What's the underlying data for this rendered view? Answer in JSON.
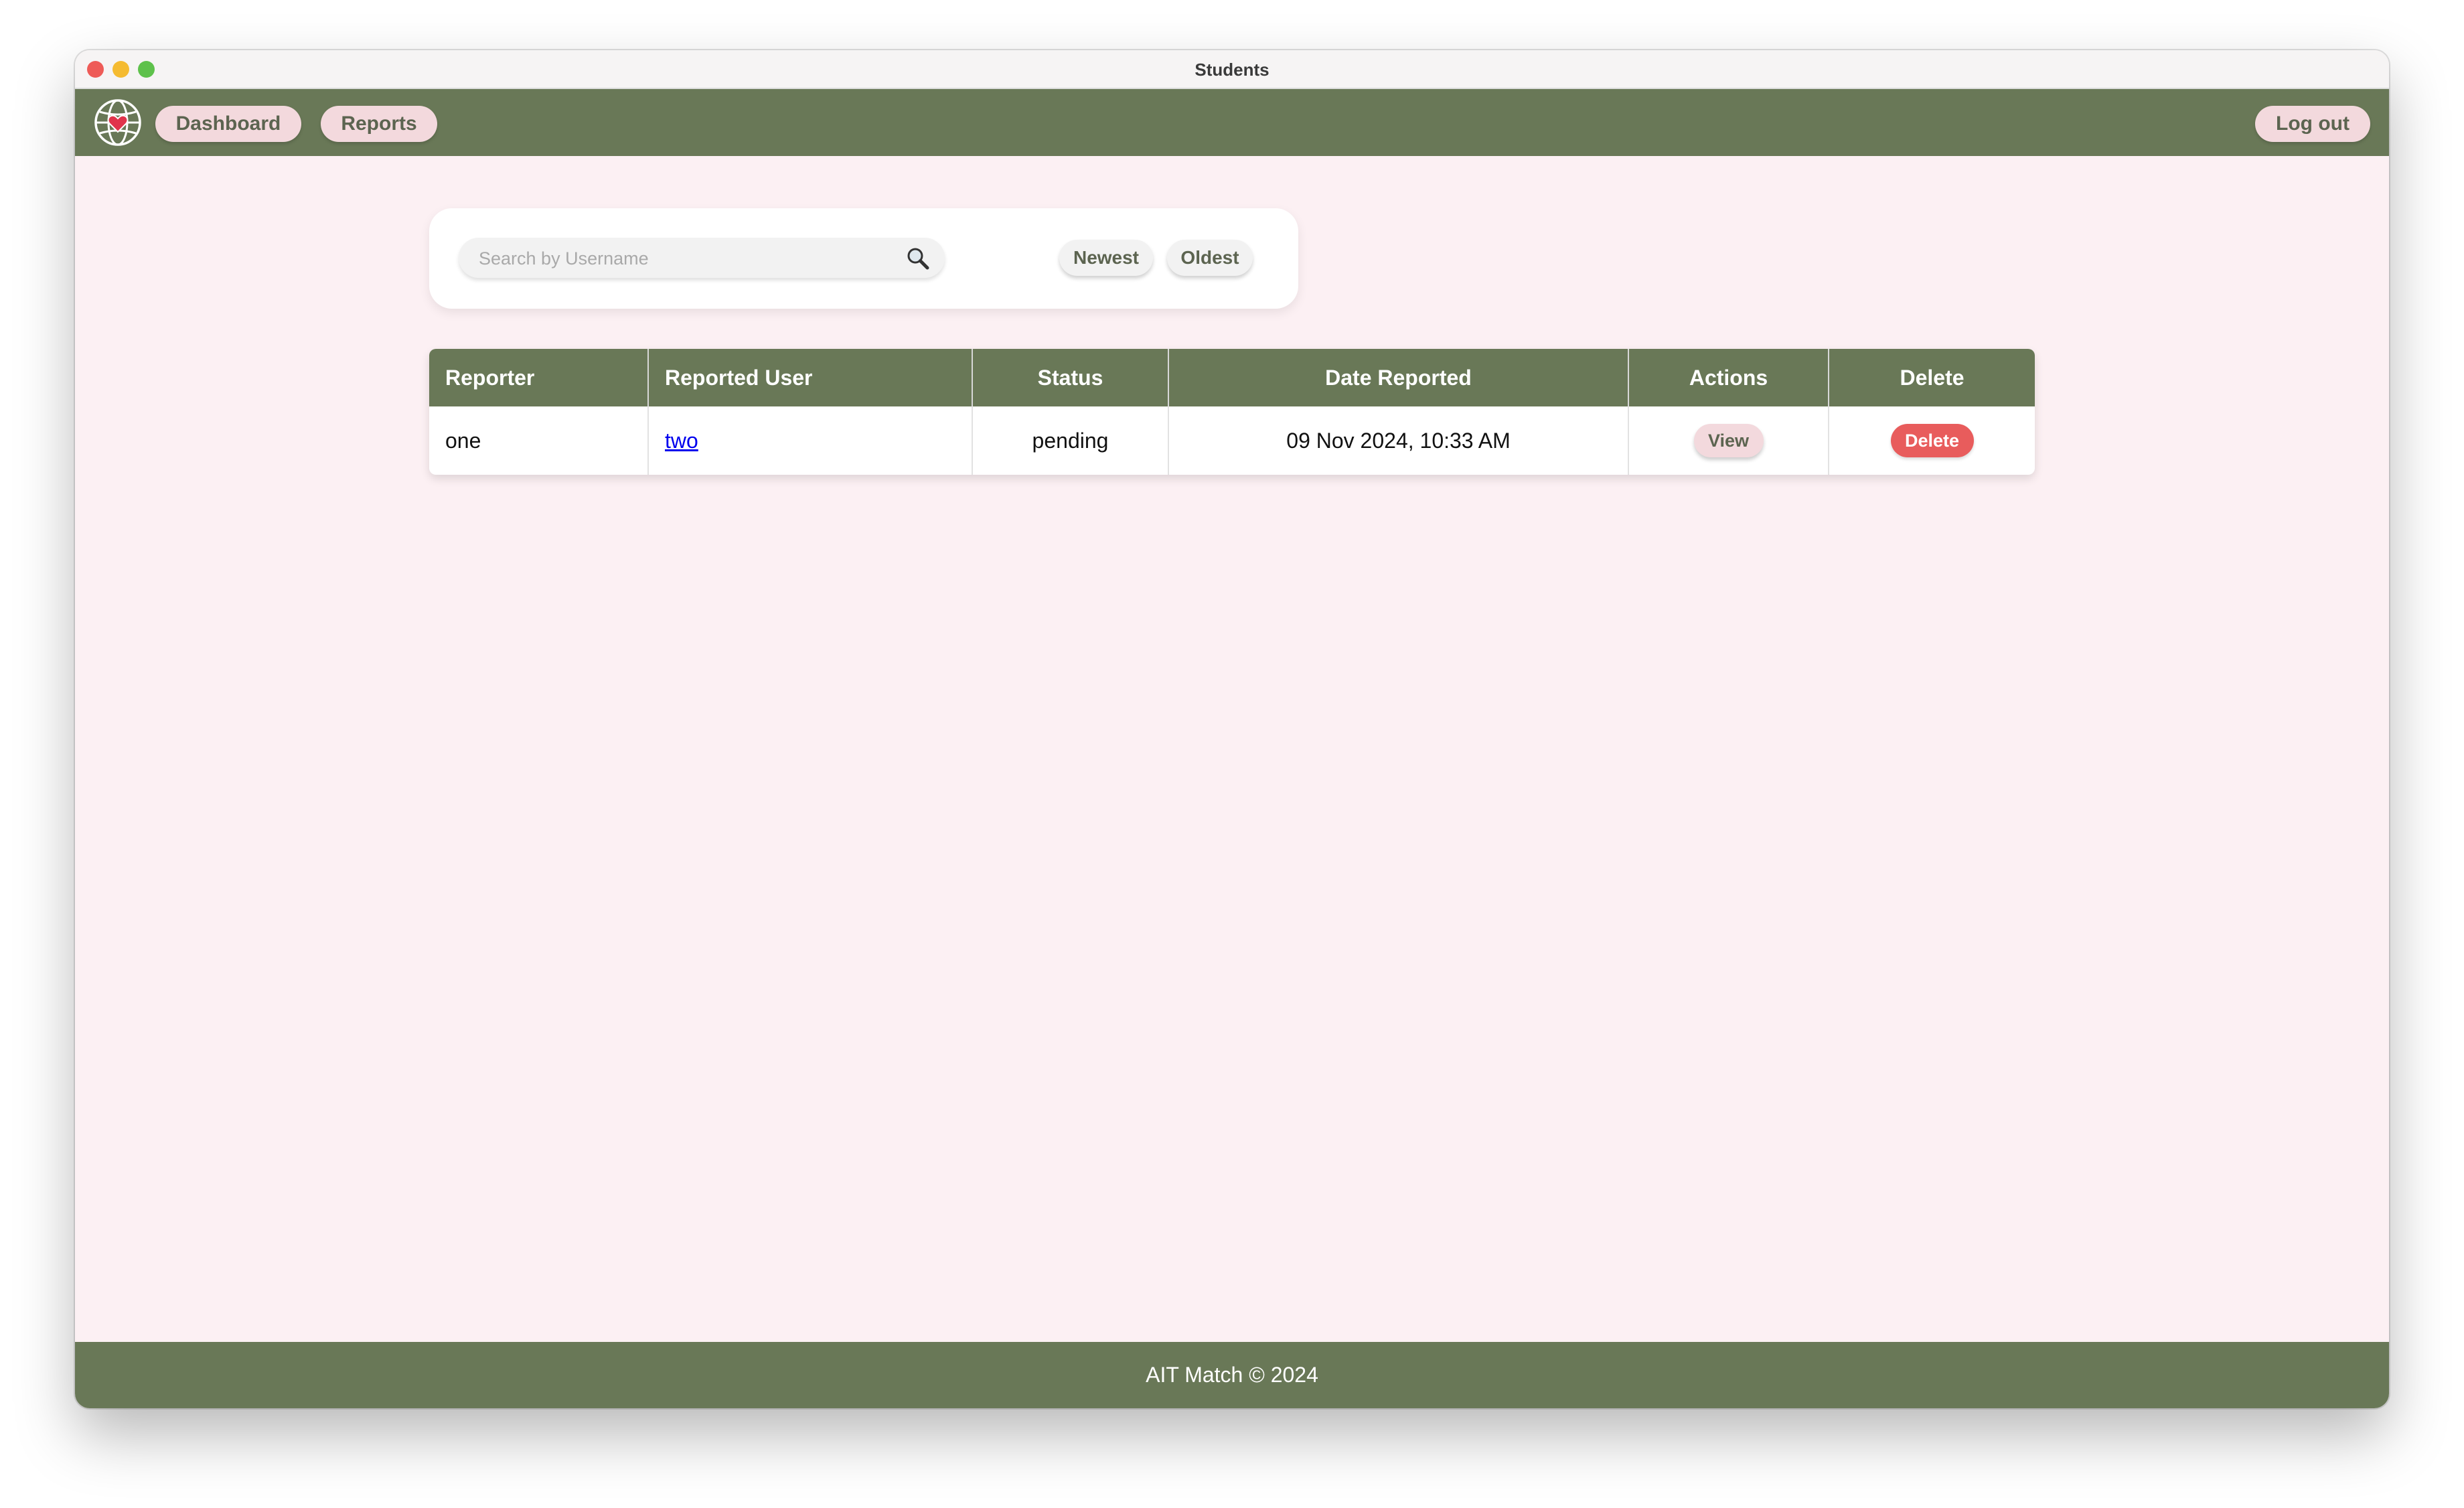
{
  "window": {
    "title": "Students"
  },
  "navbar": {
    "logo_icon": "globe-heart-icon",
    "dashboard_label": "Dashboard",
    "reports_label": "Reports",
    "logout_label": "Log out"
  },
  "search": {
    "placeholder": "Search by Username",
    "value": "",
    "icon": "search-icon",
    "sort_newest": "Newest",
    "sort_oldest": "Oldest"
  },
  "table": {
    "headers": [
      "Reporter",
      "Reported User",
      "Status",
      "Date Reported",
      "Actions",
      "Delete"
    ],
    "rows": [
      {
        "reporter": "one",
        "reported_user": "two",
        "status": "pending",
        "date_reported": "09 Nov 2024, 10:33 AM",
        "action_label": "View",
        "delete_label": "Delete"
      }
    ]
  },
  "footer": {
    "text": "AIT Match © 2024"
  },
  "colors": {
    "primary": "#697857",
    "background": "#fcf0f3",
    "button_pink": "#f3d9dd",
    "danger": "#e85c5c",
    "link": "#0000ee"
  }
}
